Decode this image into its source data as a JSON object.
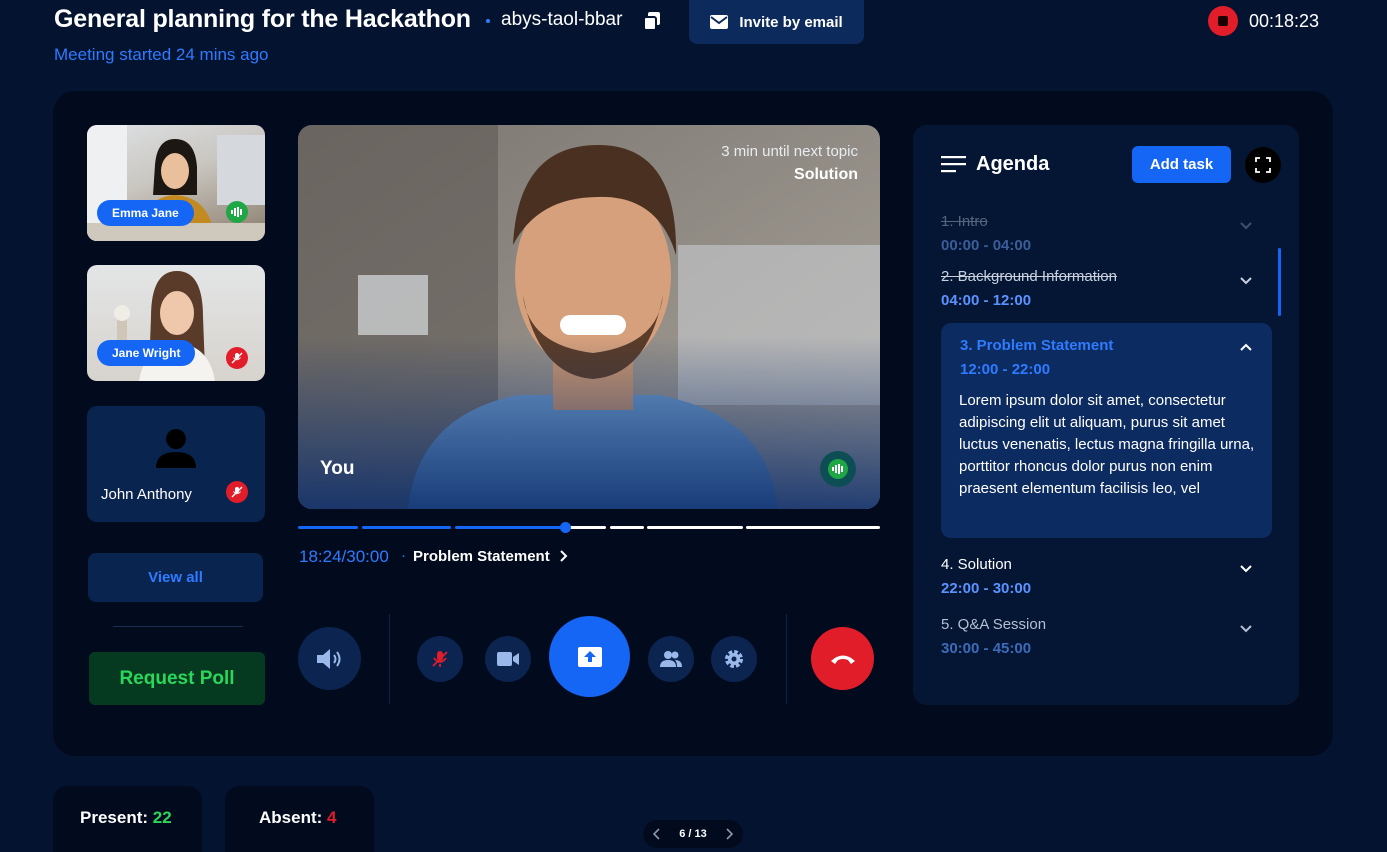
{
  "header": {
    "title": "General planning for the Hackathon",
    "meeting_code": "abys-taol-bbar",
    "invite_label": "Invite by email",
    "elapsed": "00:18:23",
    "started_text": "Meeting started 24 mins ago"
  },
  "participants": [
    {
      "name": "Emma Jane",
      "status": "speaking"
    },
    {
      "name": "Jane Wright",
      "status": "muted"
    },
    {
      "name": "John Anthony",
      "status": "muted"
    }
  ],
  "view_all_label": "View all",
  "request_poll_label": "Request Poll",
  "main_video": {
    "countdown": "3 min until next topic",
    "next_topic": "Solution",
    "speaker_label": "You"
  },
  "timeline": {
    "position": "18:24/30:00",
    "separator": "·",
    "current_topic": "Problem Statement",
    "progress_fraction": 0.46
  },
  "controls": [
    "volume-button",
    "mic-button",
    "camera-button",
    "share-screen-button",
    "participants-button",
    "settings-button",
    "end-call-button"
  ],
  "agenda": {
    "title": "Agenda",
    "add_task_label": "Add task",
    "items": [
      {
        "name": "1. Intro",
        "time": "00:00 - 04:00",
        "state": "done"
      },
      {
        "name": "2. Background Information",
        "time": "04:00 - 12:00",
        "state": "done"
      },
      {
        "name": "3. Problem Statement",
        "time": "12:00 - 22:00",
        "state": "active",
        "description": "Lorem ipsum dolor sit amet, consectetur adipiscing elit ut aliquam, purus sit amet luctus venenatis, lectus magna fringilla urna, porttitor rhoncus dolor purus non enim praesent elementum facilisis leo, vel"
      },
      {
        "name": "4. Solution",
        "time": "22:00 - 30:00",
        "state": "upcoming"
      },
      {
        "name": "5. Q&A Session",
        "time": "30:00 - 45:00",
        "state": "upcoming"
      }
    ]
  },
  "stats": {
    "present_label": "Present:",
    "present_count": "22",
    "absent_label": "Absent:",
    "absent_count": "4"
  },
  "pager": {
    "text": "6 / 13"
  },
  "colors": {
    "accent": "#1566f5",
    "danger": "#e11d2a",
    "success": "#2bd65a",
    "background": "#031330"
  }
}
